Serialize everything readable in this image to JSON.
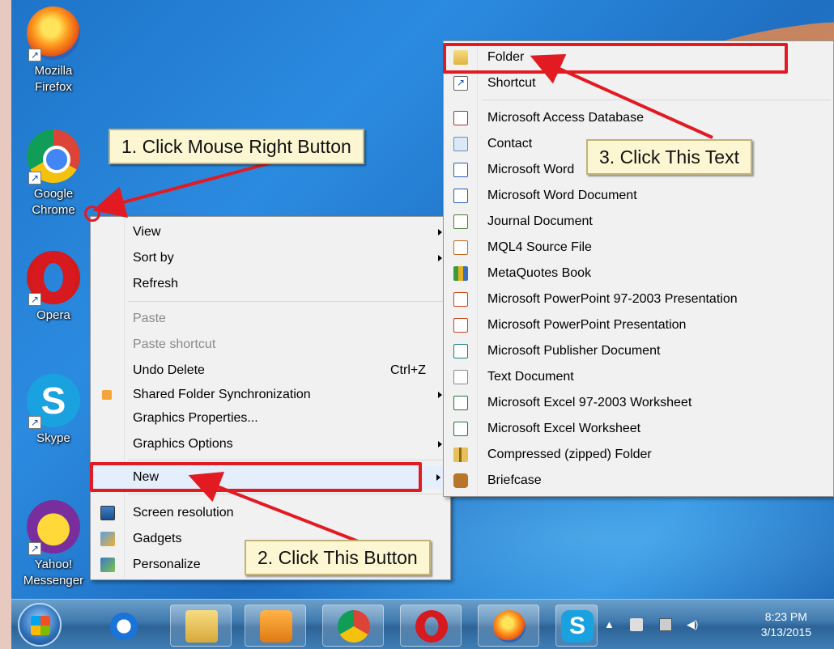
{
  "desktop": {
    "icons": [
      {
        "label_line1": "Mozilla",
        "label_line2": "Firefox"
      },
      {
        "label_line1": "Google",
        "label_line2": "Chrome"
      },
      {
        "label_line1": "Opera",
        "label_line2": ""
      },
      {
        "label_line1": "Skype",
        "label_line2": ""
      },
      {
        "label_line1": "Yahoo!",
        "label_line2": "Messenger"
      }
    ]
  },
  "context_menu": {
    "items": [
      {
        "label": "View"
      },
      {
        "label": "Sort by"
      },
      {
        "label": "Refresh"
      },
      {
        "label": "Paste"
      },
      {
        "label": "Paste shortcut"
      },
      {
        "label": "Undo Delete",
        "accelerator": "Ctrl+Z"
      },
      {
        "label": "Shared Folder Synchronization"
      },
      {
        "label": "Graphics Properties..."
      },
      {
        "label": "Graphics Options"
      },
      {
        "label": "New"
      },
      {
        "label": "Screen resolution"
      },
      {
        "label": "Gadgets"
      },
      {
        "label": "Personalize"
      }
    ]
  },
  "new_submenu": {
    "items": [
      {
        "label": "Folder"
      },
      {
        "label": "Shortcut"
      },
      {
        "label": "Microsoft Access Database"
      },
      {
        "label": "Contact"
      },
      {
        "label": "Microsoft Word"
      },
      {
        "label": "Microsoft Word Document"
      },
      {
        "label": "Journal Document"
      },
      {
        "label": "MQL4 Source File"
      },
      {
        "label": "MetaQuotes Book"
      },
      {
        "label": "Microsoft PowerPoint 97-2003 Presentation"
      },
      {
        "label": "Microsoft PowerPoint Presentation"
      },
      {
        "label": "Microsoft Publisher Document"
      },
      {
        "label": "Text Document"
      },
      {
        "label": "Microsoft Excel 97-2003 Worksheet"
      },
      {
        "label": "Microsoft Excel Worksheet"
      },
      {
        "label": "Compressed (zipped) Folder"
      },
      {
        "label": "Briefcase"
      }
    ]
  },
  "callouts": {
    "step1": "1. Click Mouse Right Button",
    "step2": "2. Click This Button",
    "step3": "3. Click This Text"
  },
  "taskbar": {
    "clock_time": "8:23 PM",
    "clock_date": "3/13/2015",
    "show_hidden_glyph": "▲",
    "volume_glyph": "◀)"
  },
  "colors": {
    "highlight_red": "#e21b23",
    "callout_bg": "#fdf6d2",
    "desktop_blue": "#1e74c8"
  }
}
